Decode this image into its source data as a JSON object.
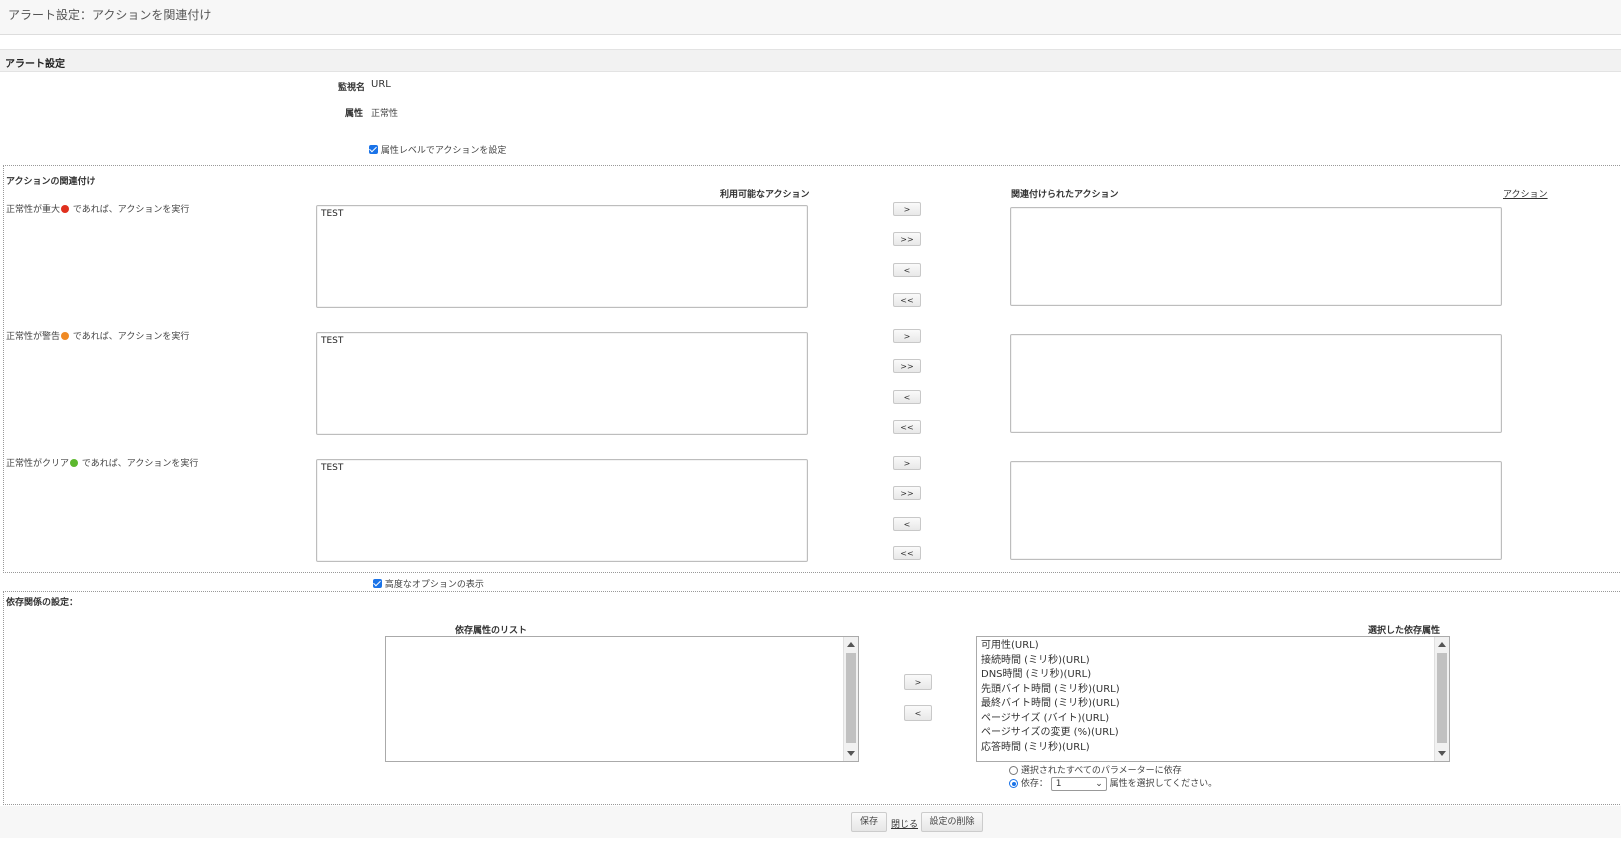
{
  "page_title": "アラート設定：アクションを関連付け",
  "alert_section": {
    "heading": "アラート設定",
    "monitor_name_label": "監視名",
    "monitor_name_value": "URL",
    "attribute_label": "属性",
    "attribute_value": "正常性",
    "attribute_level_checkbox_label": "属性レベルでアクションを設定"
  },
  "action_section": {
    "heading": "アクションの関連付け",
    "available_header": "利用可能なアクション",
    "associated_header": "関連付けられたアクション",
    "actions_link": "アクション",
    "rows": [
      {
        "label_prefix": "正常性が重大",
        "label_suffix": "であれば、アクションを実行",
        "dot_color": "#e0301e",
        "available_items": [
          "TEST"
        ]
      },
      {
        "label_prefix": "正常性が警告",
        "label_suffix": "であれば、アクションを実行",
        "dot_color": "#f08a24",
        "available_items": [
          "TEST"
        ]
      },
      {
        "label_prefix": "正常性がクリア",
        "label_suffix": "であれば、アクションを実行",
        "dot_color": "#5cb82e",
        "available_items": [
          "TEST"
        ]
      }
    ],
    "move_buttons": [
      ">",
      ">>",
      "<",
      "<<"
    ]
  },
  "advanced_option_label": "高度なオプションの表示",
  "dependency_section": {
    "heading": "依存関係の設定：",
    "list_header": "依存属性のリスト",
    "selected_header": "選択した依存属性",
    "move_buttons": [
      ">",
      "<"
    ],
    "selected_items": [
      "可用性(URL)",
      "接続時間 (ミリ秒)(URL)",
      "DNS時間 (ミリ秒)(URL)",
      "先頭バイト時間 (ミリ秒)(URL)",
      "最終バイト時間 (ミリ秒)(URL)",
      "ページサイズ (バイト)(URL)",
      "ページサイズの変更 (%)(URL)",
      "応答時間 (ミリ秒)(URL)"
    ],
    "radio_all_label": "選択されたすべてのパラメーターに依存",
    "radio_dep_label": "依存：",
    "dep_select_value": "1",
    "dep_suffix": "属性を選択してください。"
  },
  "footer": {
    "save": "保存",
    "close": "閉じる",
    "delete": "設定の削除"
  }
}
